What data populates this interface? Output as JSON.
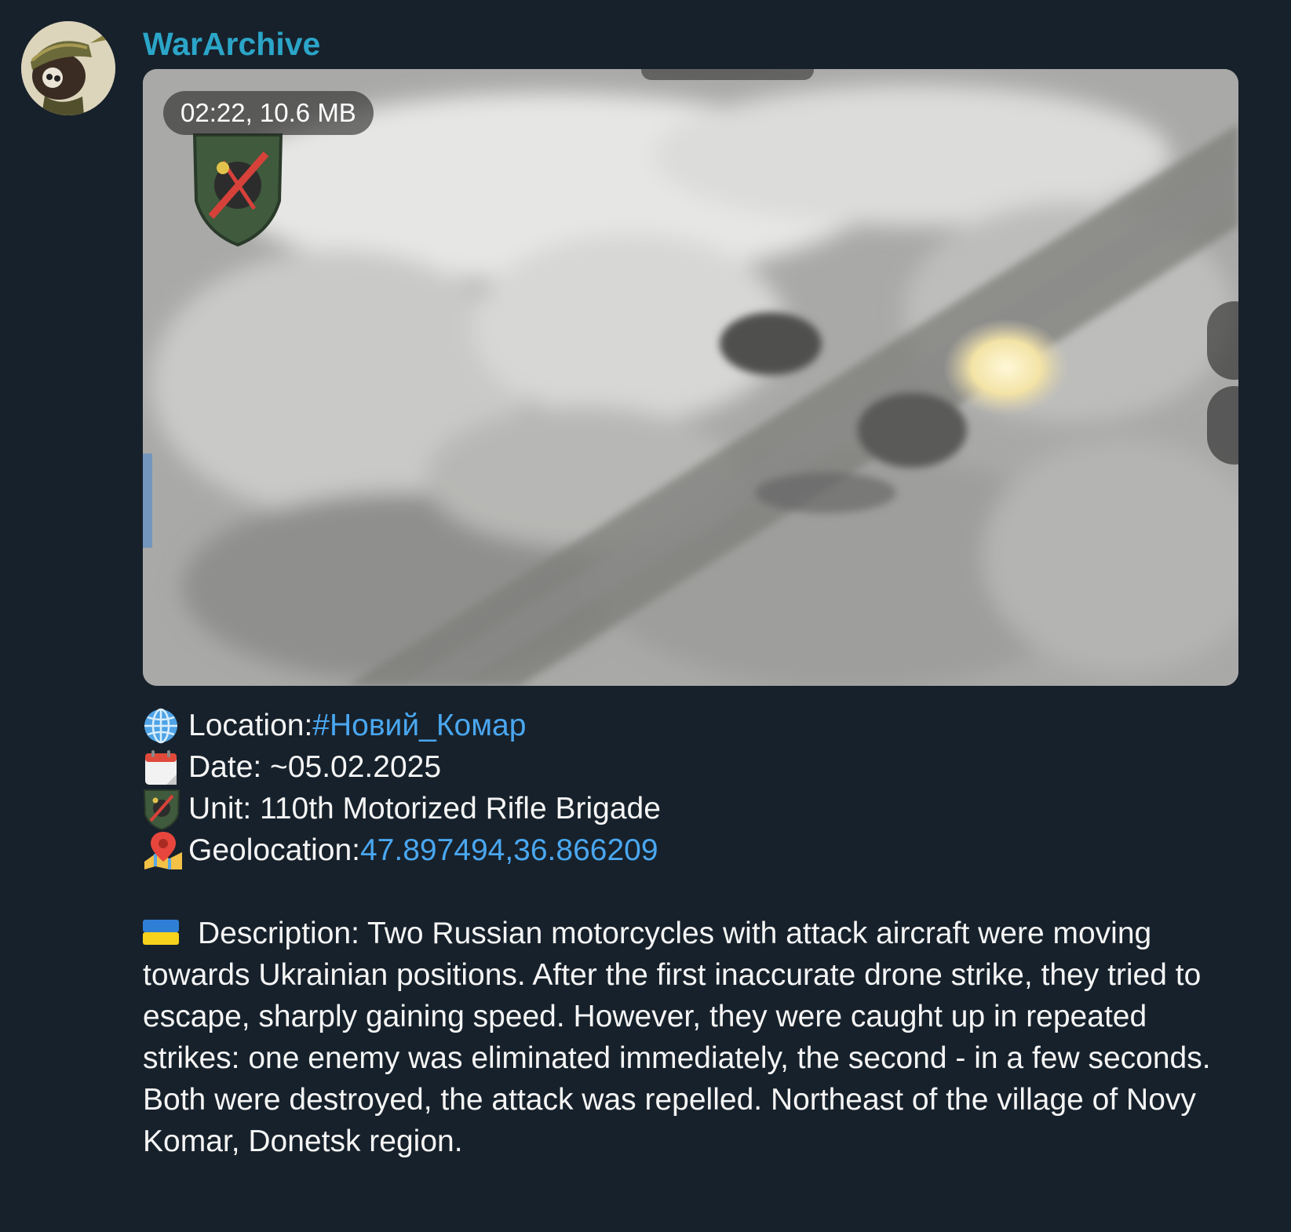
{
  "message": {
    "sender": "WarArchive",
    "sender_color": "#2ba5c8",
    "avatar_icon": "soldier-helmet-avatar-icon",
    "media": {
      "type": "video",
      "duration_size": "02:22, 10.6 MB",
      "watermark_icon": "brigade-shield-icon"
    },
    "caption": {
      "location_icon": "globe-icon",
      "location_label": "Location: ",
      "location_value": "#Новий_Комар",
      "date_icon": "calendar-icon",
      "date_text": "Date: ~05.02.2025",
      "unit_icon": "brigade-shield-icon",
      "unit_text": "Unit: 110th Motorized Rifle Brigade",
      "geo_icon": "map-pin-icon",
      "geo_label": "Geolocation: ",
      "geo_value": "47.897494,36.866209",
      "description_flag_icon": "ukraine-flag-icon",
      "description": "Description: Two Russian motorcycles with attack aircraft were moving towards Ukrainian positions. After the first inaccurate drone strike, they tried to escape, sharply gaining speed. However, they were caught up in repeated strikes: one enemy was eliminated immediately, the second - in a few seconds. Both were destroyed, the attack was repelled. Northeast of the village of Novy Komar, Donetsk region."
    },
    "link_color": "#4aa7f0",
    "background_color": "#17212b"
  }
}
